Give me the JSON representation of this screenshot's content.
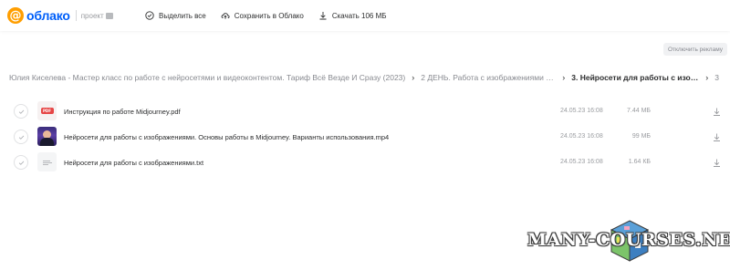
{
  "header": {
    "logo_text": "облако",
    "logo_sub": "проект",
    "actions": {
      "select_all": "Выделить все",
      "save_to_cloud": "Сохранить в Облако",
      "download": "Скачать 106 МБ"
    }
  },
  "ad_button": "Отключить рекламу",
  "breadcrumb": {
    "items": [
      "Юлия Киселева - Мастер класс по работе с нейросетями и видеоконтентом. Тариф Всё Везде И Сразу (2023)",
      "2 ДЕНЬ. Работа с изображениями и...",
      "3. Нейросети для работы с изобра...",
      "3"
    ]
  },
  "files": [
    {
      "name": "Инструкция по работе Midjourney.pdf",
      "date": "24.05.23 16:08",
      "size": "7.44 МБ",
      "type": "pdf"
    },
    {
      "name": "Нейросети для работы с изображениями. Основы работы в Midjourney. Варианты использования.mp4",
      "date": "24.05.23 16:08",
      "size": "99 МБ",
      "type": "video"
    },
    {
      "name": "Нейросети для работы с изображениями.txt",
      "date": "24.05.23 16:08",
      "size": "1.64 КБ",
      "type": "txt"
    }
  ],
  "watermark": "MANY-COURSES.NET",
  "colors": {
    "brand_orange": "#ff9e00",
    "brand_blue": "#005ff9",
    "text_primary": "#2c2d2e",
    "text_secondary": "#9a9ca0"
  }
}
